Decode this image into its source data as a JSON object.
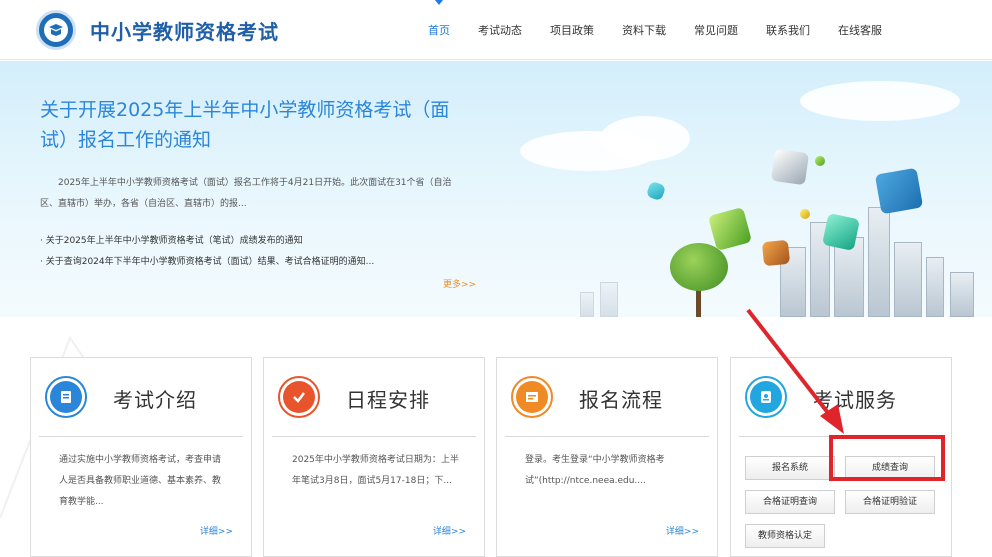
{
  "header": {
    "site_title": "中小学教师资格考试",
    "nav": [
      {
        "label": "首页",
        "active": true
      },
      {
        "label": "考试动态",
        "active": false
      },
      {
        "label": "项目政策",
        "active": false
      },
      {
        "label": "资料下载",
        "active": false
      },
      {
        "label": "常见问题",
        "active": false
      },
      {
        "label": "联系我们",
        "active": false
      },
      {
        "label": "在线客服",
        "active": false
      }
    ]
  },
  "banner": {
    "title": "关于开展2025年上半年中小学教师资格考试（面试）报名工作的通知",
    "summary": "2025年上半年中小学教师资格考试（面试）报名工作将于4月21日开始。此次面试在31个省（自治区、直辖市）举办，各省（自治区、直辖市）的报...",
    "links": [
      "关于2025年上半年中小学教师资格考试（笔试）成绩发布的通知",
      "关于查询2024年下半年中小学教师资格考试（面试）结果、考试合格证明的通知..."
    ],
    "more_label": "更多>>"
  },
  "cards": [
    {
      "title": "考试介绍",
      "icon": "exam-intro-icon",
      "body": "通过实施中小学教师资格考试，考查申请人是否具备教师职业道德、基本素养、教育教学能...",
      "detail_label": "详细>>"
    },
    {
      "title": "日程安排",
      "icon": "schedule-check-icon",
      "body": "2025年中小学教师资格考试日期为：上半年笔试3月8日，面试5月17-18日；下...",
      "detail_label": "详细>>"
    },
    {
      "title": "报名流程",
      "icon": "registration-icon",
      "body": "登录。考生登录“中小学教师资格考试”(http://ntce.neea.edu....",
      "detail_label": "详细>>"
    },
    {
      "title": "考试服务",
      "icon": "service-contact-icon"
    }
  ],
  "services": {
    "buttons": [
      "报名系统",
      "成绩查询",
      "合格证明查询",
      "合格证明验证",
      "教师资格认定"
    ]
  },
  "colors": {
    "brand_blue": "#1f5fa8",
    "accent_blue": "#2b86d9",
    "more_orange": "#f28c28",
    "highlight_red": "#e0242b"
  }
}
